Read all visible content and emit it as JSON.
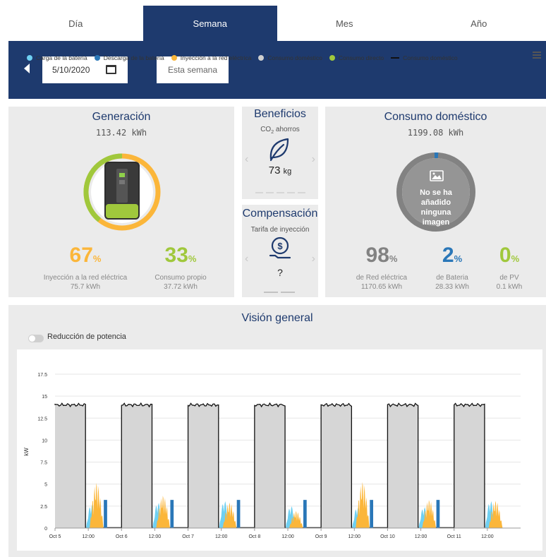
{
  "tabs": [
    "Día",
    "Semana",
    "Mes",
    "Año"
  ],
  "toolbar": {
    "date": "5/10/2020",
    "week_button": "Esta semana"
  },
  "generacion": {
    "title": "Generación",
    "total": "113.42 kWh",
    "left_pct": "67",
    "left_label": "Inyección a la red eléctrica",
    "left_value": "75.7 kWh",
    "right_pct": "33",
    "right_label": "Consumo propio",
    "right_value": "37.72 kWh",
    "unit": "%"
  },
  "beneficios": {
    "title": "Beneficios",
    "subtitle_prefix": "CO",
    "subtitle_sub": "2",
    "subtitle_suffix": " ahorros",
    "value": "73",
    "unit": "kg"
  },
  "compensacion": {
    "title": "Compensación",
    "subtitle": "Tarifa de inyección",
    "value": "?"
  },
  "consumo": {
    "title": "Consumo doméstico",
    "total": "1199.08 kWh",
    "image_text": "No se ha añadido ninguna imagen",
    "items": [
      {
        "pct": "98",
        "label": "de Red eléctrica",
        "value": "1170.65 kWh"
      },
      {
        "pct": "2",
        "label": "de Bateria",
        "value": "28.33 kWh"
      },
      {
        "pct": "0",
        "label": "de PV",
        "value": "0.1 kWh"
      }
    ],
    "unit": "%"
  },
  "overview": {
    "title": "Visión general",
    "toggle_label": "Reducción de potencia"
  },
  "colors": {
    "navy": "#1e3a6e",
    "orange": "#fbb63a",
    "green": "#a0c83c",
    "grey": "#828282",
    "blue": "#2a77b8",
    "light_blue": "#6fd0f2",
    "house_grey": "#d3d3d3"
  },
  "chart_data": {
    "type": "area",
    "ylabel": "kW",
    "yticks": [
      "0",
      "2.5",
      "5",
      "7.5",
      "10",
      "12.5",
      "15",
      "17.5"
    ],
    "ylim": [
      0,
      17.5
    ],
    "xticks": [
      "Oct 5",
      "12:00",
      "Oct 6",
      "12:00",
      "Oct 7",
      "12:00",
      "Oct 8",
      "12:00",
      "Oct 9",
      "12:00",
      "Oct 10",
      "12:00",
      "Oct 11",
      "12:00"
    ],
    "legend": [
      {
        "name": "Carga de la batería",
        "color": "#6fd0f2",
        "marker": "dot"
      },
      {
        "name": "Descarga de la batería",
        "color": "#2a77b8",
        "marker": "dot"
      },
      {
        "name": "Inyección a la red eléctrica",
        "color": "#fbb63a",
        "marker": "dot"
      },
      {
        "name": "Consumo doméstico",
        "color": "#cfcfcf",
        "marker": "dot"
      },
      {
        "name": "Consumo directo",
        "color": "#a0c83c",
        "marker": "dot"
      },
      {
        "name": "Consumo doméstico",
        "color": "#111111",
        "marker": "line"
      }
    ],
    "x_unit": "hours_from_Oct5_00:00",
    "days": 7,
    "consumption_level": 14.0,
    "consumption_on_hours": [
      0,
      11
    ],
    "consumption_off_level": 0,
    "charge_peak": 2.8,
    "injection_peaks": [
      5.3,
      3.8,
      3.0,
      2.0,
      5.4,
      3.3,
      3.2
    ],
    "charge_peaks": [
      2.8,
      3.0,
      3.2,
      2.6,
      2.5,
      2.5,
      3.2
    ],
    "discharge_peaks": [
      3.2,
      3.2,
      3.2,
      3.2,
      3.2,
      3.2,
      0
    ]
  }
}
